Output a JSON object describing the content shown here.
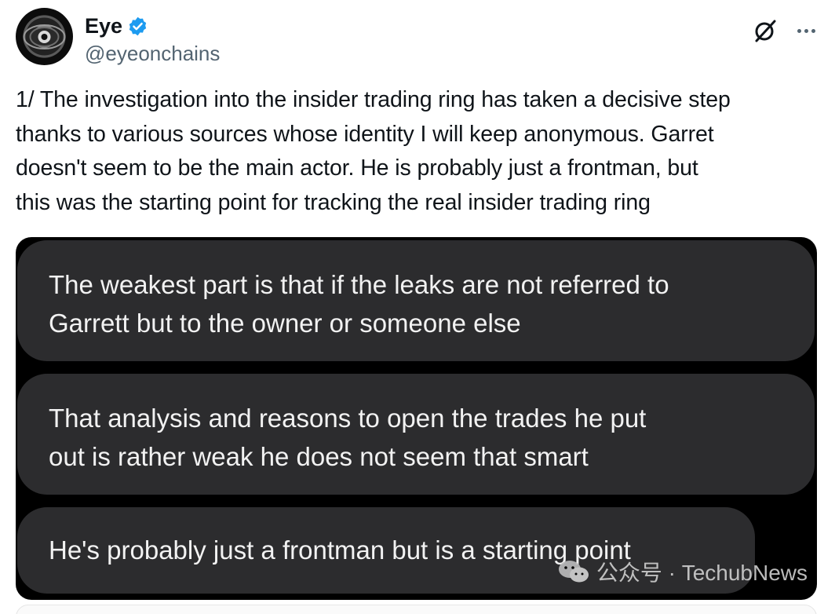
{
  "author": {
    "display_name": "Eye",
    "handle": "@eyeonchains",
    "verified": true,
    "accent_color": "#1d9bf0"
  },
  "icons": {
    "grok": "grok-icon",
    "more": "more-icon",
    "verified": "verified-badge-icon"
  },
  "tweet": {
    "text": "1/ The investigation into the insider trading ring has taken a decisive step\nthanks to various sources whose identity I will keep anonymous. Garret\ndoesn't seem to be the main actor. He is probably just a frontman, but\nthis was the starting point for tracking the real insider trading ring"
  },
  "media": {
    "messages": [
      "The weakest part is that if the leaks are not referred to\nGarrett but to the owner or someone else",
      "That analysis and reasons to open the trades he put\nout is rather weak he does not seem that smart",
      "He's probably just a frontman but is a starting point"
    ],
    "watermark": "公众号 · TechubNews"
  }
}
